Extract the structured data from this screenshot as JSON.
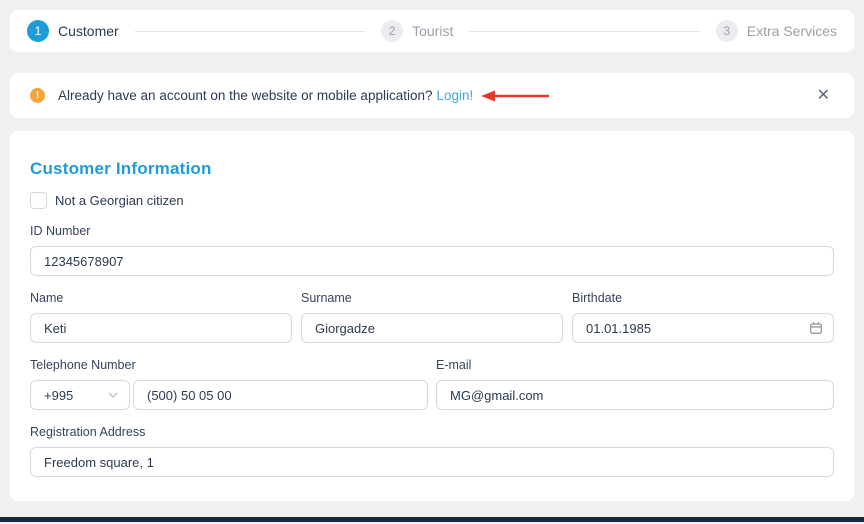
{
  "stepper": {
    "steps": [
      {
        "number": "1",
        "label": "Customer"
      },
      {
        "number": "2",
        "label": "Tourist"
      },
      {
        "number": "3",
        "label": "Extra Services"
      }
    ]
  },
  "banner": {
    "warning_icon": "!",
    "message": "Already have an account on the website or mobile application?",
    "login_label": "Login!",
    "close_icon": "✕"
  },
  "form": {
    "title": "Customer Information",
    "citizen_checkbox_label": "Not a Georgian citizen",
    "fields": {
      "id_number": {
        "label": "ID Number",
        "value": "12345678907"
      },
      "name": {
        "label": "Name",
        "value": "Keti"
      },
      "surname": {
        "label": "Surname",
        "value": "Giorgadze"
      },
      "birthdate": {
        "label": "Birthdate",
        "value": "01.01.1985"
      },
      "phone": {
        "label": "Telephone Number",
        "country_code": "+995",
        "value": "(500) 50 05 00"
      },
      "email": {
        "label": "E-mail",
        "value": "MG@gmail.com"
      },
      "address": {
        "label": "Registration Address",
        "value": "Freedom square, 1"
      }
    }
  },
  "colors": {
    "accent_blue": "#1e9cd7",
    "link_blue": "#41a8e0",
    "warning_orange": "#f0a63a",
    "annotation_red": "#e23b2e",
    "inactive_gray": "#9ba1a9",
    "text_dark": "#2b3a52",
    "bottom_bar": "#16293e"
  }
}
